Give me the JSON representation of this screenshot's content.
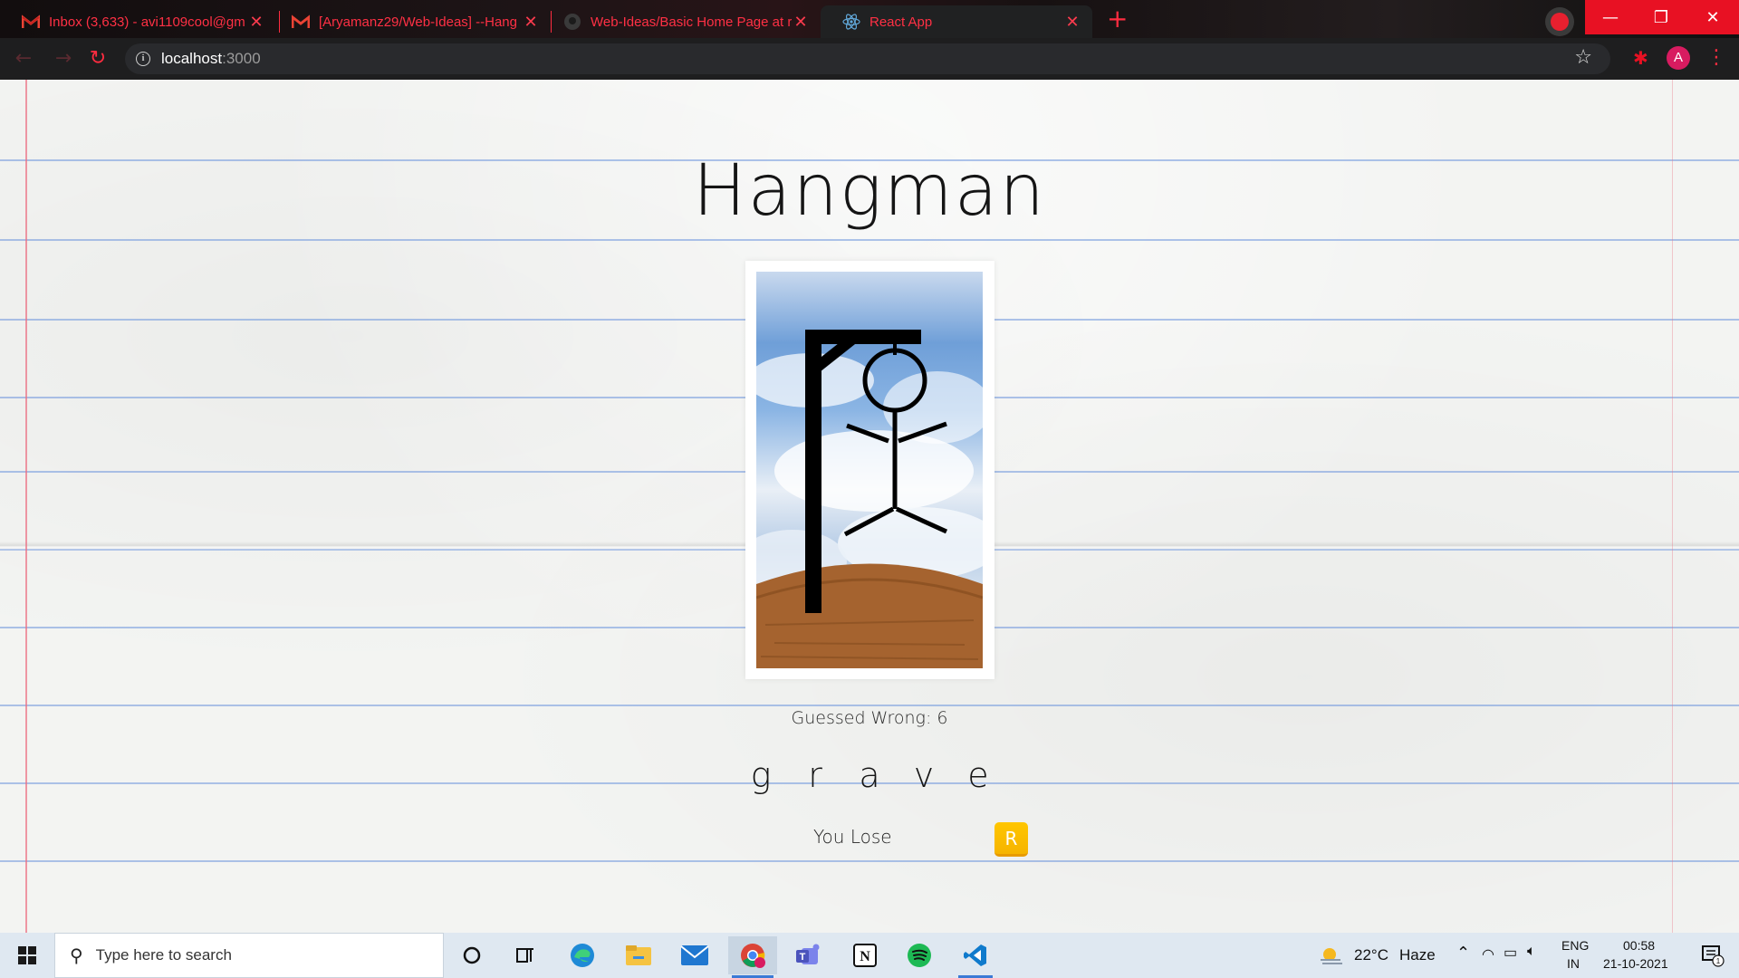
{
  "browser": {
    "tabs": [
      {
        "title": "Inbox (3,633) - avi1109cool@gm",
        "icon": "gmail-icon"
      },
      {
        "title": "[Aryamanz29/Web-Ideas] --Hang",
        "icon": "gmail-icon"
      },
      {
        "title": "Web-Ideas/Basic Home Page at r",
        "icon": "github-icon"
      },
      {
        "title": "React App",
        "icon": "react-icon"
      }
    ],
    "new_tab": "+",
    "url_host": "localhost",
    "url_port": ":3000",
    "profile_initial": "A",
    "accent_color": "#ff2c40"
  },
  "game": {
    "title": "Hangman",
    "wrong_label": "Guessed Wrong: ",
    "wrong_count": "6",
    "answer_letters": [
      "g",
      "r",
      "a",
      "v",
      "e"
    ],
    "result": "You Lose",
    "reset_label": "R"
  },
  "taskbar": {
    "search_placeholder": "Type here to search",
    "apps": [
      "cortana-icon",
      "task-view-icon",
      "edge-icon",
      "file-explorer-icon",
      "mail-icon",
      "chrome-icon",
      "teams-icon",
      "notion-icon",
      "spotify-icon",
      "vscode-icon"
    ],
    "weather_temp": "22°C",
    "weather_condition": "Haze",
    "lang_top": "ENG",
    "lang_bottom": "IN",
    "time": "00:58",
    "date": "21-10-2021",
    "notification_count": "1"
  }
}
